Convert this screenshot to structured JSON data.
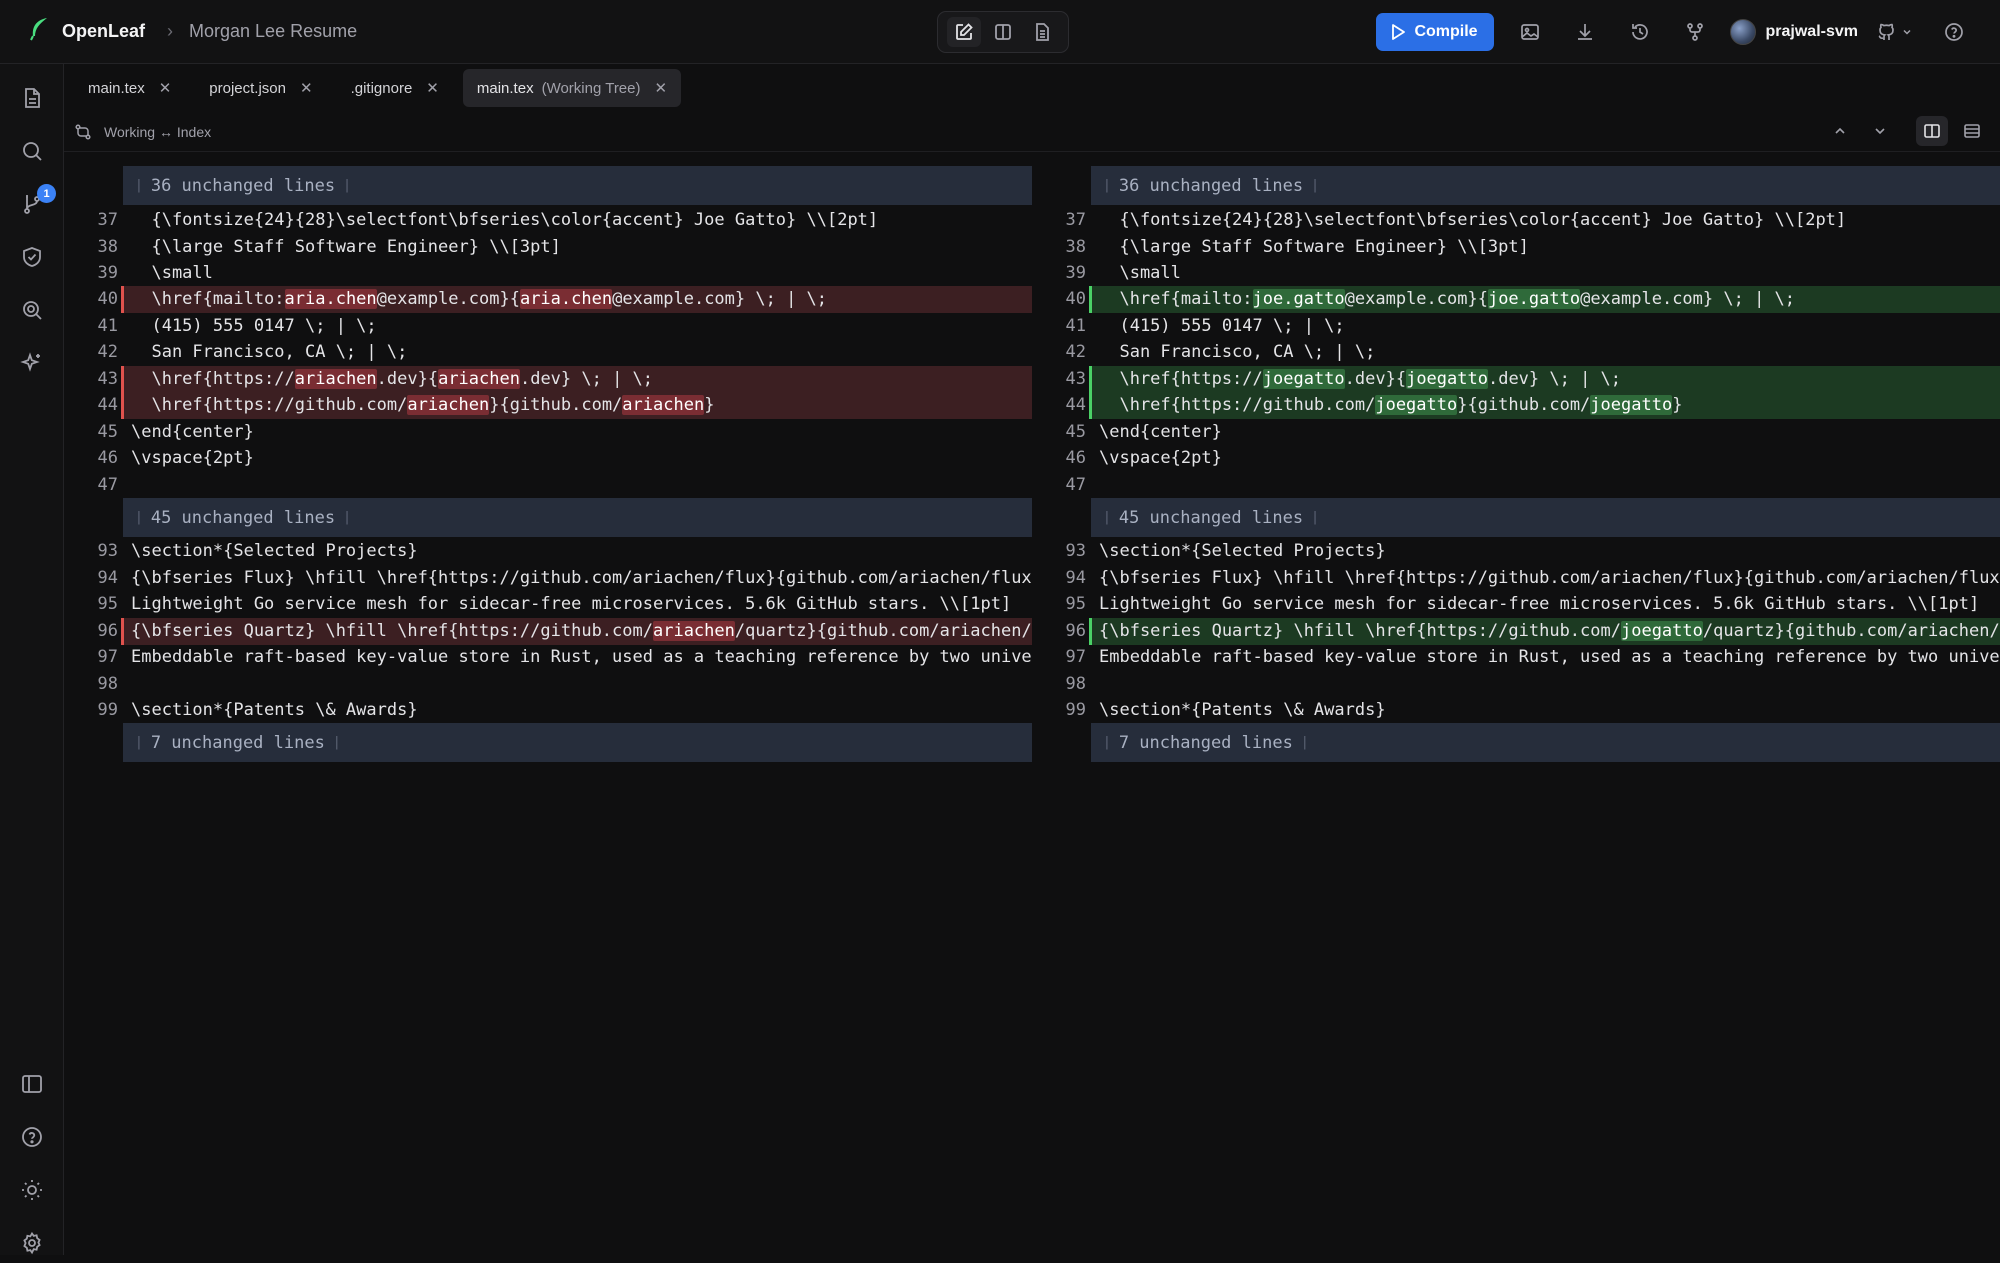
{
  "app": {
    "name": "OpenLeaf",
    "project": "Morgan Lee Resume"
  },
  "toolbar": {
    "compile_label": "Compile",
    "user": "prajwal-svm"
  },
  "sidebar": {
    "source_control_badge": "1"
  },
  "tabs": [
    {
      "label": "main.tex",
      "suffix": "",
      "active": false
    },
    {
      "label": "project.json",
      "suffix": "",
      "active": false
    },
    {
      "label": ".gitignore",
      "suffix": "",
      "active": false
    },
    {
      "label": "main.tex",
      "suffix": "(Working Tree)",
      "active": true
    }
  ],
  "diff": {
    "compare_label": "Working ↔ Index",
    "fold_1": "36 unchanged lines",
    "fold_2": "45 unchanged lines",
    "fold_3": "7 unchanged lines",
    "line_numbers": {
      "l37": "37",
      "l38": "38",
      "l39": "39",
      "l40": "40",
      "l41": "41",
      "l42": "42",
      "l43": "43",
      "l44": "44",
      "l45": "45",
      "l46": "46",
      "l47": "47",
      "l93": "93",
      "l94": "94",
      "l95": "95",
      "l96": "96",
      "l97": "97",
      "l98": "98",
      "l99": "99"
    },
    "left": {
      "l37": "  {\\fontsize{24}{28}\\selectfont\\bfseries\\color{accent} Joe Gatto} \\\\[2pt]",
      "l38": "  {\\large Staff Software Engineer} \\\\[3pt]",
      "l39": "  \\small",
      "l40_a": "  \\href{mailto:",
      "l40_h1": "aria.chen",
      "l40_b": "@example.com}{",
      "l40_h2": "aria.chen",
      "l40_c": "@example.com} \\; | \\;",
      "l41": "  (415) 555 0147 \\; | \\;",
      "l42": "  San Francisco, CA \\; | \\;",
      "l43_a": "  \\href{https://",
      "l43_h1": "ariachen",
      "l43_b": ".dev}{",
      "l43_h2": "ariachen",
      "l43_c": ".dev} \\; | \\;",
      "l44_a": "  \\href{https://github.com/",
      "l44_h1": "ariachen",
      "l44_b": "}{github.com/",
      "l44_h2": "ariachen",
      "l44_c": "}",
      "l45": "\\end{center}",
      "l46": "\\vspace{2pt}",
      "l47": "",
      "l93": "\\section*{Selected Projects}",
      "l94": "{\\bfseries Flux} \\hfill \\href{https://github.com/ariachen/flux}{github.com/ariachen/flux}",
      "l95": "Lightweight Go service mesh for sidecar-free microservices. 5.6k GitHub stars. \\\\[1pt]",
      "l96_a": "{\\bfseries Quartz} \\hfill \\href{https://github.com/",
      "l96_h1": "ariachen",
      "l96_b": "/quartz}{github.com/ariachen/quartz}",
      "l97": "Embeddable raft-based key-value store in Rust, used as a teaching reference by two universities.",
      "l98": "",
      "l99": "\\section*{Patents \\& Awards}"
    },
    "right": {
      "l37": "  {\\fontsize{24}{28}\\selectfont\\bfseries\\color{accent} Joe Gatto} \\\\[2pt]",
      "l38": "  {\\large Staff Software Engineer} \\\\[3pt]",
      "l39": "  \\small",
      "l40_a": "  \\href{mailto:",
      "l40_h1": "joe.gatto",
      "l40_b": "@example.com}{",
      "l40_h2": "joe.gatto",
      "l40_c": "@example.com} \\; | \\;",
      "l41": "  (415) 555 0147 \\; | \\;",
      "l42": "  San Francisco, CA \\; | \\;",
      "l43_a": "  \\href{https://",
      "l43_h1": "joegatto",
      "l43_b": ".dev}{",
      "l43_h2": "joegatto",
      "l43_c": ".dev} \\; | \\;",
      "l44_a": "  \\href{https://github.com/",
      "l44_h1": "joegatto",
      "l44_b": "}{github.com/",
      "l44_h2": "joegatto",
      "l44_c": "}",
      "l45": "\\end{center}",
      "l46": "\\vspace{2pt}",
      "l47": "",
      "l93": "\\section*{Selected Projects}",
      "l94": "{\\bfseries Flux} \\hfill \\href{https://github.com/ariachen/flux}{github.com/ariachen/flux}",
      "l95": "Lightweight Go service mesh for sidecar-free microservices. 5.6k GitHub stars. \\\\[1pt]",
      "l96_a": "{\\bfseries Quartz} \\hfill \\href{https://github.com/",
      "l96_h1": "joegatto",
      "l96_b": "/quartz}{github.com/ariachen/quartz}",
      "l97": "Embeddable raft-based key-value store in Rust, used as a teaching reference by two universities.",
      "l98": "",
      "l99": "\\section*{Patents \\& Awards}"
    }
  },
  "colors": {
    "accent": "#2b6fe6",
    "deleted": "#e0524d",
    "inserted": "#4ad166"
  }
}
